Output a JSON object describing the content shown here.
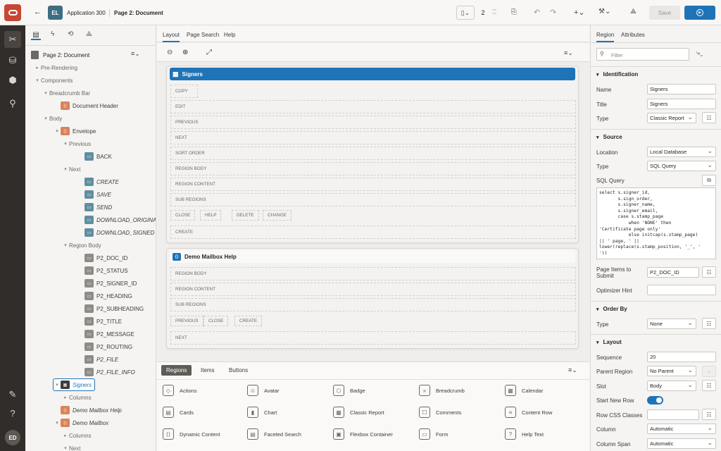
{
  "header": {
    "app_badge": "EL",
    "app_name": "Application 300",
    "page_name": "Page 2: Document",
    "page_number": "2",
    "save_label": "Save",
    "avatar": "ED"
  },
  "tree": {
    "tabs": [
      "rendering-tab",
      "dynamic-actions-tab",
      "processing-tab",
      "shared-components-tab"
    ],
    "page_title": "Page 2: Document",
    "rows": [
      {
        "label": "Pre-Rendering",
        "indent": 0,
        "twisty": "▸",
        "icon": "none",
        "italic": false
      },
      {
        "label": "Components",
        "indent": 0,
        "twisty": "▾",
        "icon": "none",
        "italic": false
      },
      {
        "label": "Breadcrumb Bar",
        "indent": 1,
        "twisty": "▾",
        "icon": "none",
        "italic": false
      },
      {
        "label": "Document Header",
        "indent": 2,
        "twisty": "",
        "icon": "orange",
        "italic": false
      },
      {
        "label": "Body",
        "indent": 1,
        "twisty": "▾",
        "icon": "none",
        "italic": false
      },
      {
        "label": "Envelope",
        "indent": 2,
        "twisty": "▾",
        "icon": "orange",
        "italic": false
      },
      {
        "label": "Previous",
        "indent": 3,
        "twisty": "▾",
        "icon": "none",
        "italic": false
      },
      {
        "label": "BACK",
        "indent": 4,
        "twisty": "",
        "icon": "teal",
        "italic": false
      },
      {
        "label": "Next",
        "indent": 3,
        "twisty": "▾",
        "icon": "none",
        "italic": false
      },
      {
        "label": "CREATE",
        "indent": 4,
        "twisty": "",
        "icon": "teal",
        "italic": true
      },
      {
        "label": "SAVE",
        "indent": 4,
        "twisty": "",
        "icon": "teal",
        "italic": true
      },
      {
        "label": "SEND",
        "indent": 4,
        "twisty": "",
        "icon": "teal",
        "italic": true
      },
      {
        "label": "DOWNLOAD_ORIGINAL",
        "indent": 4,
        "twisty": "",
        "icon": "teal",
        "italic": true
      },
      {
        "label": "DOWNLOAD_SIGNED",
        "indent": 4,
        "twisty": "",
        "icon": "teal",
        "italic": true
      },
      {
        "label": "Region Body",
        "indent": 3,
        "twisty": "▾",
        "icon": "none",
        "italic": false
      },
      {
        "label": "P2_DOC_ID",
        "indent": 4,
        "twisty": "",
        "icon": "gray",
        "italic": false
      },
      {
        "label": "P2_STATUS",
        "indent": 4,
        "twisty": "",
        "icon": "gray",
        "italic": false
      },
      {
        "label": "P2_SIGNER_ID",
        "indent": 4,
        "twisty": "",
        "icon": "gray",
        "italic": false
      },
      {
        "label": "P2_HEADING",
        "indent": 4,
        "twisty": "",
        "icon": "gray",
        "italic": false
      },
      {
        "label": "P2_SUBHEADING",
        "indent": 4,
        "twisty": "",
        "icon": "gray",
        "italic": false
      },
      {
        "label": "P2_TITLE",
        "indent": 4,
        "twisty": "",
        "icon": "gray",
        "italic": false
      },
      {
        "label": "P2_MESSAGE",
        "indent": 4,
        "twisty": "",
        "icon": "gray",
        "italic": false
      },
      {
        "label": "P2_ROUTING",
        "indent": 4,
        "twisty": "",
        "icon": "gray",
        "italic": false
      },
      {
        "label": "P2_FILE",
        "indent": 4,
        "twisty": "",
        "icon": "gray",
        "italic": true
      },
      {
        "label": "P2_FILE_INFO",
        "indent": 4,
        "twisty": "",
        "icon": "gray",
        "italic": true
      },
      {
        "label": "Signers",
        "indent": 2,
        "twisty": "▾",
        "icon": "dark",
        "italic": true,
        "selected": true
      },
      {
        "label": "Columns",
        "indent": 3,
        "twisty": "▸",
        "icon": "none",
        "italic": false
      },
      {
        "label": "Demo Mailbox Help",
        "indent": 2,
        "twisty": "",
        "icon": "orange",
        "italic": true
      },
      {
        "label": "Demo Mailbox",
        "indent": 2,
        "twisty": "▾",
        "icon": "orange",
        "italic": true
      },
      {
        "label": "Columns",
        "indent": 3,
        "twisty": "▸",
        "icon": "none",
        "italic": false
      },
      {
        "label": "Next",
        "indent": 3,
        "twisty": "▾",
        "icon": "none",
        "italic": false
      }
    ]
  },
  "center": {
    "tabs": [
      "Layout",
      "Page Search",
      "Help"
    ],
    "region1": {
      "title": "Signers",
      "slots": [
        "COPY",
        "EDIT",
        "PREVIOUS",
        "NEXT",
        "SORT ORDER",
        "REGION BODY",
        "REGION CONTENT",
        "SUB REGIONS"
      ],
      "buttons": [
        "CLOSE",
        "HELP",
        "DELETE",
        "CHANGE"
      ],
      "last": "CREATE"
    },
    "region2": {
      "title": "Demo Mailbox Help",
      "slots": [
        "REGION BODY",
        "REGION CONTENT",
        "SUB REGIONS"
      ],
      "buttons": [
        "PREVIOUS",
        "CLOSE",
        "CREATE"
      ],
      "last": "NEXT"
    }
  },
  "gallery": {
    "tabs": [
      "Regions",
      "Items",
      "Buttons"
    ],
    "items": [
      {
        "label": "Actions",
        "icon": "◇"
      },
      {
        "label": "Avatar",
        "icon": "☺"
      },
      {
        "label": "Badge",
        "icon": "⬡"
      },
      {
        "label": "Breadcrumb",
        "icon": "»"
      },
      {
        "label": "Calendar",
        "icon": "▦"
      },
      {
        "label": "Cards",
        "icon": "▤"
      },
      {
        "label": "Chart",
        "icon": "▮"
      },
      {
        "label": "Classic Report",
        "icon": "▦"
      },
      {
        "label": "Comments",
        "icon": "☐"
      },
      {
        "label": "Content Row",
        "icon": "≡"
      },
      {
        "label": "Dynamic Content",
        "icon": "⟨⟩"
      },
      {
        "label": "Faceted Search",
        "icon": "▤"
      },
      {
        "label": "Flexbox Container",
        "icon": "▣"
      },
      {
        "label": "Form",
        "icon": "▭"
      },
      {
        "label": "Help Text",
        "icon": "?"
      }
    ]
  },
  "props": {
    "tabs": [
      "Region",
      "Attributes"
    ],
    "filter_placeholder": "Filter",
    "identification": {
      "section": "Identification",
      "name_label": "Name",
      "name": "Signers",
      "title_label": "Title",
      "title": "Signers",
      "type_label": "Type",
      "type": "Classic Report"
    },
    "source": {
      "section": "Source",
      "location_label": "Location",
      "location": "Local Database",
      "type_label": "Type",
      "type": "SQL Query",
      "sql_label": "SQL Query",
      "sql_lines": [
        "select s.signer_id,",
        "       s.sign_order,",
        "       s.signer_name,",
        "       s.signer_email,",
        "       case s.stamp_page",
        "           when 'NONE' then",
        "'Certificate page only'",
        "           else initcap(s.stamp_page)",
        "|| ' page, ' ||",
        "lower(replace(s.stamp_position, '_', '",
        "'))"
      ],
      "items_label": "Page Items to Submit",
      "items_value": "P2_DOC_ID",
      "hint_label": "Optimizer Hint"
    },
    "order": {
      "section": "Order By",
      "type_label": "Type",
      "type": "None"
    },
    "layout": {
      "section": "Layout",
      "sequence_label": "Sequence",
      "sequence": "20",
      "parent_label": "Parent Region",
      "parent": "No Parent",
      "slot_label": "Slot",
      "slot": "Body",
      "newrow_label": "Start New Row",
      "css_label": "Row CSS Classes",
      "column_label": "Column",
      "column": "Automatic",
      "span_label": "Column Span",
      "span": "Automatic"
    }
  },
  "colors": {
    "accent": "#1f73b7",
    "oracle_red": "#c74634",
    "rail": "#312d2a"
  }
}
